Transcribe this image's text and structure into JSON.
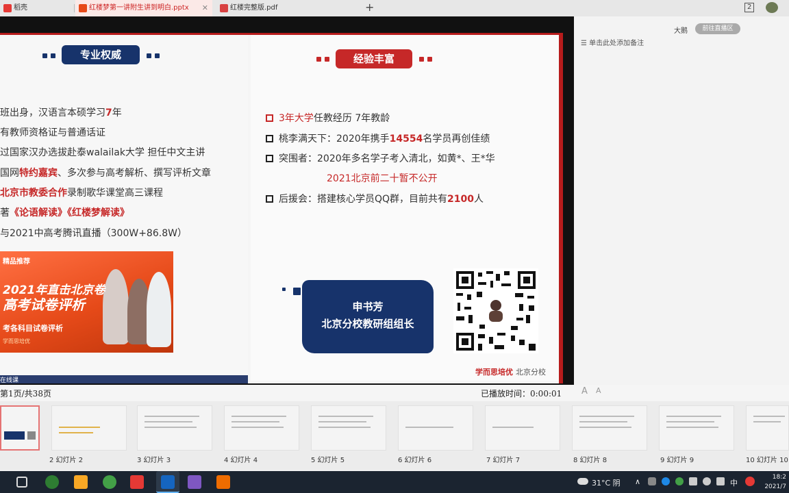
{
  "browser": {
    "tabs": [
      {
        "label": "稻壳",
        "active": false
      },
      {
        "label": "红楼梦第一讲附生讲到明白.pptx",
        "active": true
      },
      {
        "label": "红楼完整版.pdf",
        "active": false
      }
    ],
    "new_tab": "+",
    "tray_badge": "2"
  },
  "slide": {
    "left_badge": "专业权威",
    "right_badge": "经验丰富",
    "left_lines": [
      {
        "pre": "班出身，汉语言本硕学习",
        "hl": "7",
        "post": "年"
      },
      {
        "pre": "有教师资格证与普通话证",
        "hl": "",
        "post": ""
      },
      {
        "pre": "过国家汉办选拔赴泰walailak大学  担任中文主讲",
        "hl": "",
        "post": ""
      },
      {
        "pre": "国网",
        "hl": "特约嘉宾",
        "post": "、多次参与高考解析、撰写评析文章"
      },
      {
        "pre": "北京市教委合作",
        "hl": "",
        "post": "录制歌华课堂高三课程",
        "pre_hl": true
      },
      {
        "pre": "著",
        "hl": "《论语解读》《红楼梦解读》",
        "post": ""
      },
      {
        "pre": "与2021中高考腾讯直播（300W+86.8W）",
        "hl": "",
        "post": ""
      }
    ],
    "right_lines": [
      {
        "a": "3年",
        "b": "大学",
        "c": "任教经历  7年教龄"
      },
      {
        "a": "桃李满天下：2020年携手",
        "b": "14554",
        "c": "名学员再创佳绩"
      },
      {
        "a": "突围者：2020年多名学子考入清北，如黄*、王*华",
        "b": "",
        "c": ""
      },
      {
        "a": "后援会：搭建核心学员QQ群，目前共有",
        "b": "2100",
        "c": "人"
      }
    ],
    "right_subline": "2021北京前二十暂不公开",
    "promo": {
      "tag": "精品推荐",
      "line1": "2021年直击北京卷",
      "line2": "高考试卷评析",
      "line3": "考各科目试卷评析",
      "line4": "学而思培优"
    },
    "teacher_name": "申书芳",
    "teacher_title": "北京分校教研组组长",
    "brand": "学而思培优",
    "brand_sub": "北京分校",
    "bottom_band_text": "在线课"
  },
  "notes_panel": {
    "user": "大鹅",
    "button": "前往直播区",
    "hint": "单击此处添加备注"
  },
  "status": {
    "page_indicator": "第1页/共38页",
    "played_time": "已播放时间：0:00:01",
    "font_smaller": "A",
    "font_larger": "A"
  },
  "thumbnails": [
    {
      "label": "2  幻灯片 2"
    },
    {
      "label": "3  幻灯片 3"
    },
    {
      "label": "4  幻灯片 4"
    },
    {
      "label": "5  幻灯片 5"
    },
    {
      "label": "6  幻灯片 6"
    },
    {
      "label": "7  幻灯片 7"
    },
    {
      "label": "8  幻灯片 8"
    },
    {
      "label": "9  幻灯片 9"
    },
    {
      "label": "10  幻灯片 10"
    }
  ],
  "taskbar": {
    "weather": "31°C 阴",
    "ime": "中",
    "time": "18:2",
    "date": "2021/7"
  }
}
